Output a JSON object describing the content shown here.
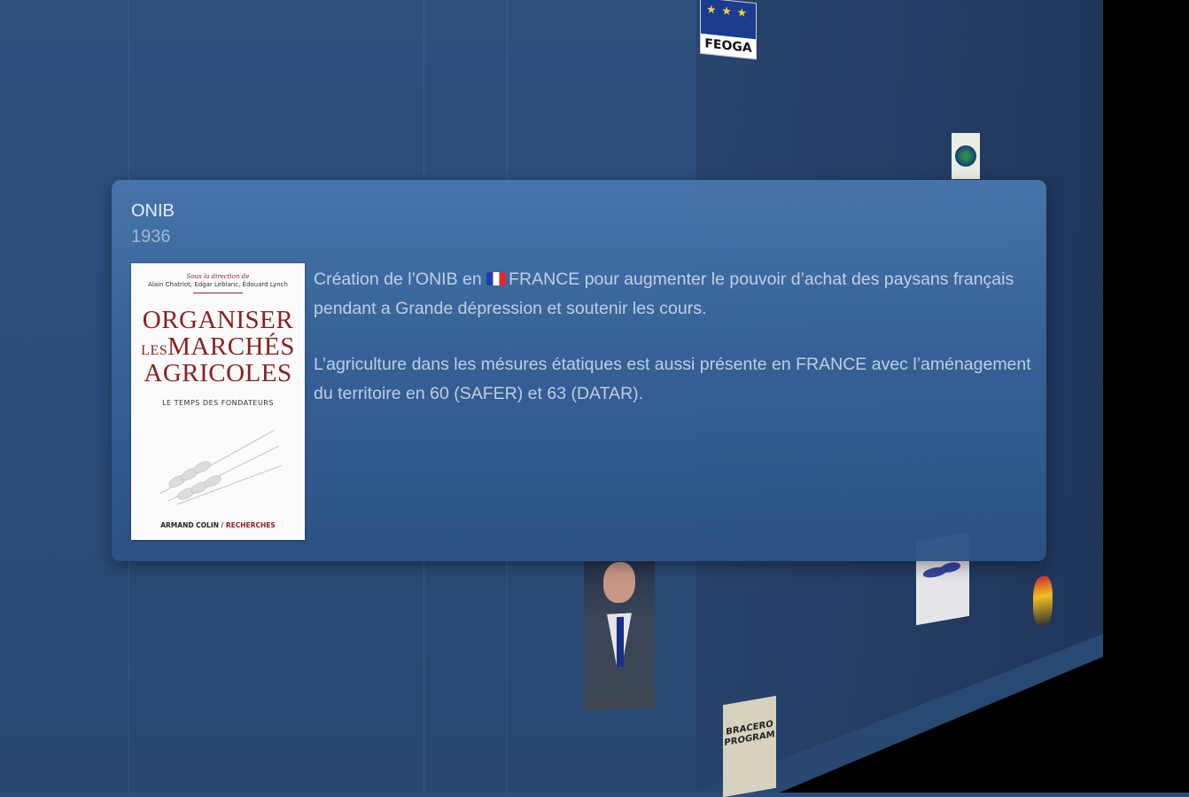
{
  "card": {
    "title": "ONIB",
    "year": "1936",
    "paragraph1_a": "Création de l’ONIB en ",
    "flag_icon": "france-flag",
    "paragraph1_b": "FRANCE pour augmenter le pouvoir d’achat des paysans français pendant a Grande dépression et soutenir les cours.",
    "paragraph2": "L’agriculture dans les mésures étatiques est aussi présente en FRANCE avec l’amé­nagement du territoire en 60 (SAFER) et 63 (DATAR).",
    "book": {
      "editors_intro": "Sous la direction de",
      "editors": "Alain Chatriot, Edgar Leblanc, Édouard Lynch",
      "line1": "ORGANISER",
      "line2_small": "LES",
      "line2": "MARCHÉS",
      "line3": "AGRICOLES",
      "subtitle": "LE TEMPS DES FONDATEURS",
      "publisher_a": "ARMAND COLIN",
      "publisher_sep": " / ",
      "publisher_b": "RECHERCHES"
    }
  },
  "background": {
    "feoga_logo_text": "FEOGA",
    "bracero_poster_text": "BRACERO PROGRAM"
  },
  "colors": {
    "background": "#2b4d79",
    "card_top": "#4676ac",
    "card_bottom": "#2c5284",
    "book_title": "#8b1f1f"
  }
}
